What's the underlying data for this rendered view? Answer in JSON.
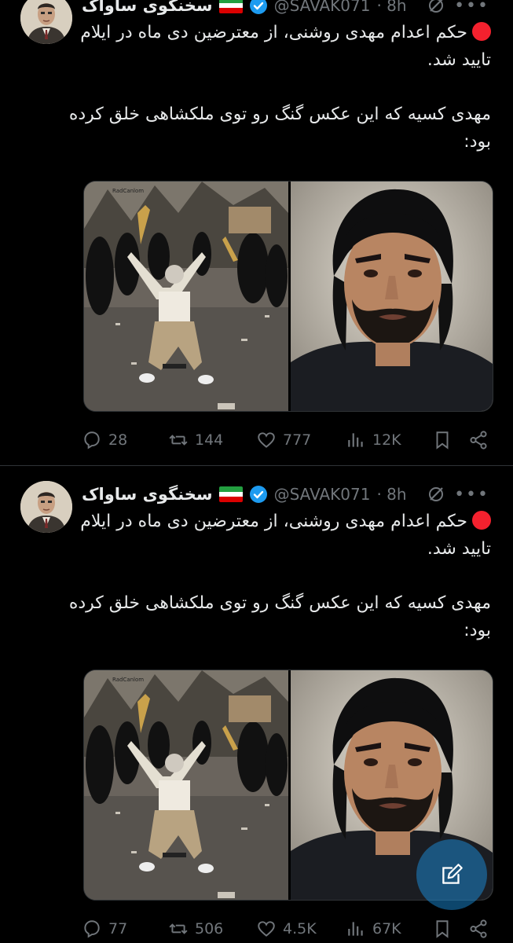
{
  "tweets": [
    {
      "author_name": "سخنگوی ساواک",
      "handle": "@SAVAK071",
      "time": "· 8h",
      "paragraph1": "حکم اعدام مهدی روشنی، از معترضین دی ماه در ایلام تایید شد.",
      "paragraph2": "مهدی کسیه که این عکس گنگ رو توی ملکشاهی خلق کرده بود:",
      "media_watermark": "RadCanlom",
      "replies": "28",
      "reposts": "144",
      "likes": "777",
      "views": "12K"
    },
    {
      "author_name": "سخنگوی ساواک",
      "handle": "@SAVAK071",
      "time": "· 8h",
      "paragraph1": "حکم اعدام مهدی روشنی، از معترضین دی ماه در ایلام تایید شد.",
      "paragraph2": "مهدی کسیه که این عکس گنگ رو توی ملکشاهی خلق کرده بود:",
      "media_watermark": "RadCanlom",
      "replies": "77",
      "reposts": "506",
      "likes": "4.5K",
      "views": "67K"
    }
  ],
  "icons": {
    "reply": "reply-icon",
    "repost": "repost-icon",
    "like": "heart-icon",
    "views": "views-icon",
    "bookmark": "bookmark-icon",
    "share": "share-icon",
    "grok": "grok-icon",
    "more": "more-icon",
    "compose": "compose-icon"
  },
  "colors": {
    "background": "#000000",
    "text": "#e7e9ea",
    "muted": "#71767b",
    "verified": "#1d9bf0",
    "red_dot": "#f4212e"
  }
}
